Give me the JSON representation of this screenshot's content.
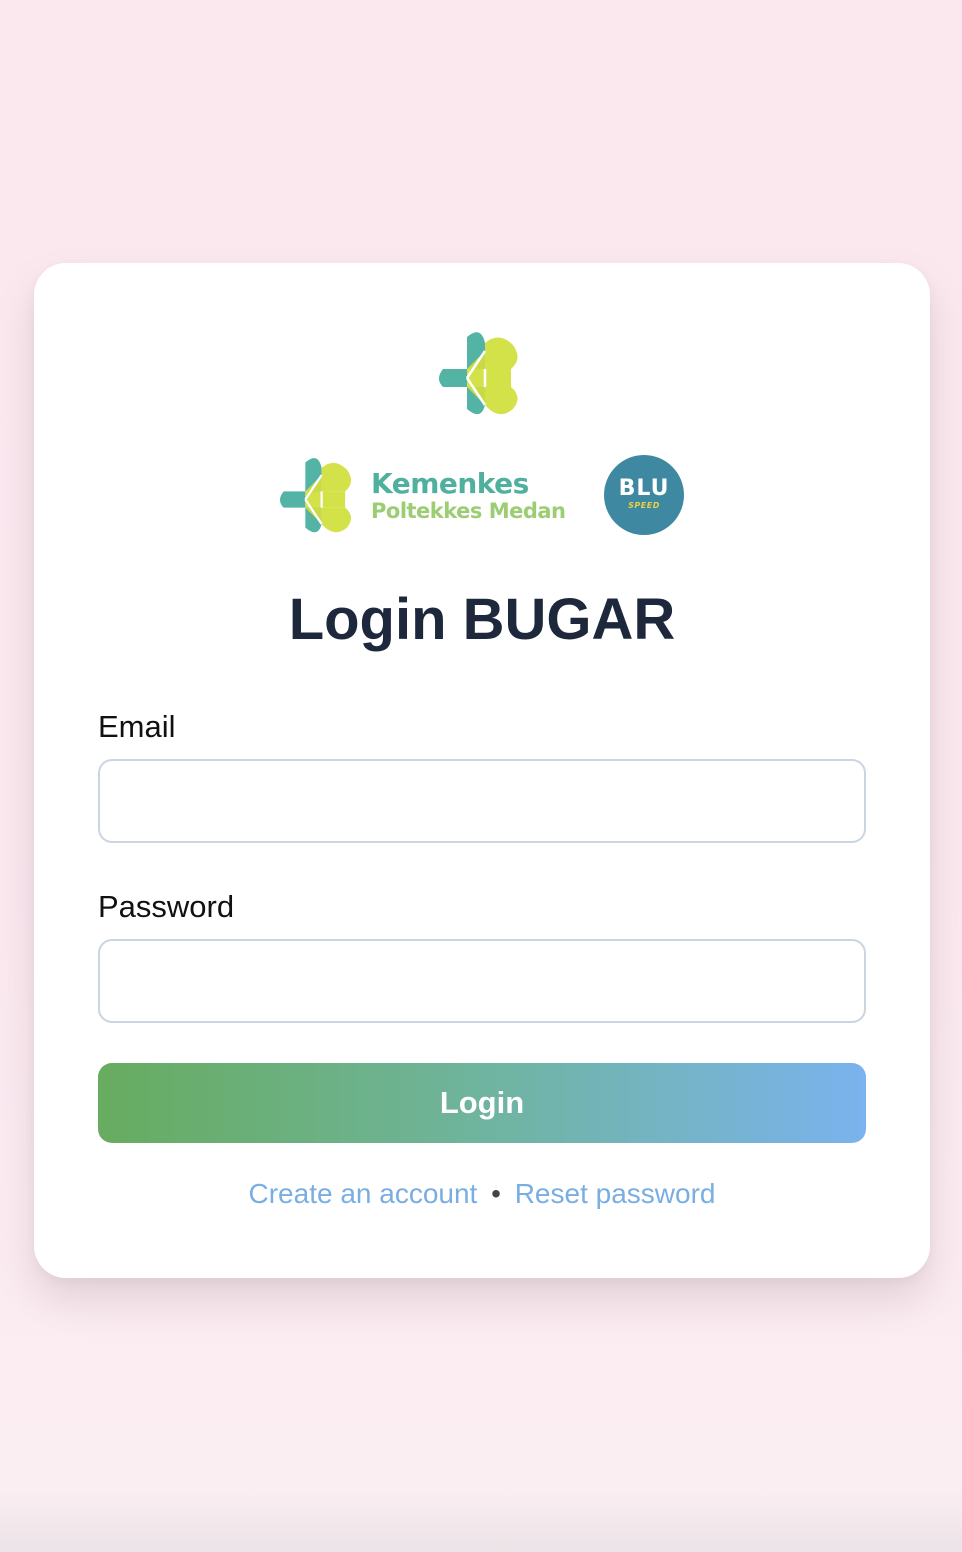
{
  "branding": {
    "kemenkes_name": "Kemenkes",
    "kemenkes_subtitle": "Poltekkes Medan",
    "blu_text": "BLU",
    "blu_subtext": "SPEED",
    "colors": {
      "teal": "#53b3a4",
      "lime": "#d4e24a",
      "blu_badge": "#3e88a2"
    }
  },
  "form": {
    "title": "Login BUGAR",
    "email_label": "Email",
    "email_value": "",
    "password_label": "Password",
    "password_value": "",
    "login_label": "Login",
    "login_gradient": [
      "#67ac5f",
      "#7ab3ee"
    ]
  },
  "links": {
    "create_account": "Create an account",
    "separator": "•",
    "reset_password": "Reset password",
    "color": "#7aaee2"
  }
}
